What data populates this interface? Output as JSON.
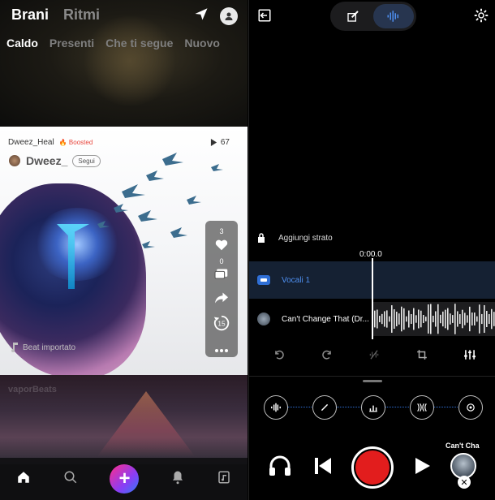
{
  "feed": {
    "top_tabs": [
      "Brani",
      "Ritmi"
    ],
    "sub_tabs": [
      "Caldo",
      "Presenti",
      "Che ti segue",
      "Nuovo"
    ],
    "post": {
      "author_handle": "Dweez_Heal",
      "boosted_label": "Boosted",
      "play_count": "67",
      "display_name": "Dweez_",
      "follow_label": "Segui",
      "beat_label": "Beat importato",
      "likes": "3",
      "comments": "0",
      "replays": "15"
    },
    "blurred_text": "vaporBeats"
  },
  "studio": {
    "add_layer_label": "Aggiungi strato",
    "time": "0:00.0",
    "tracks": [
      {
        "name": "Vocali 1"
      },
      {
        "name": "Can't Change That (Dr..."
      }
    ],
    "now_playing": "Can't Cha"
  },
  "colors": {
    "accent_blue": "#2f6fd6",
    "record_red": "#e21d1d",
    "boosted_red": "#e8453c"
  }
}
